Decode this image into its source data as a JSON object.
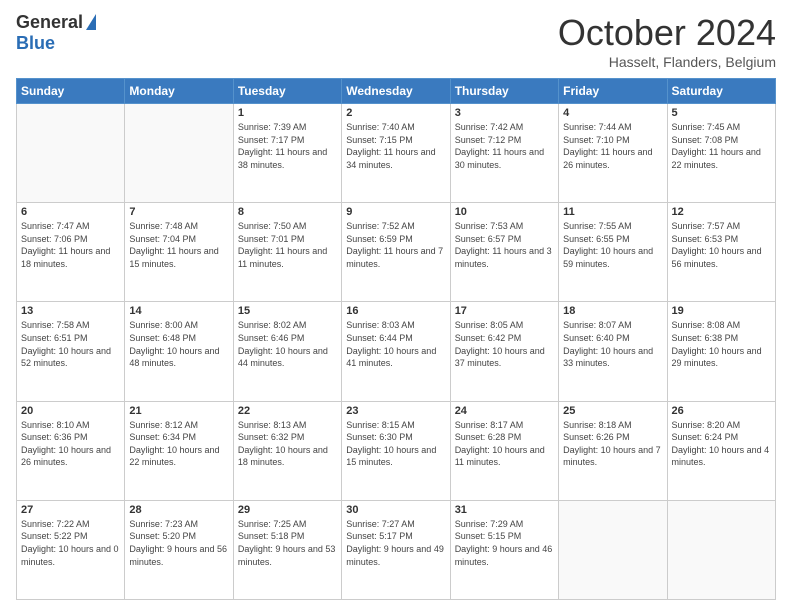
{
  "logo": {
    "general": "General",
    "blue": "Blue"
  },
  "title": "October 2024",
  "subtitle": "Hasselt, Flanders, Belgium",
  "days_of_week": [
    "Sunday",
    "Monday",
    "Tuesday",
    "Wednesday",
    "Thursday",
    "Friday",
    "Saturday"
  ],
  "weeks": [
    [
      {
        "day": "",
        "sunrise": "",
        "sunset": "",
        "daylight": ""
      },
      {
        "day": "",
        "sunrise": "",
        "sunset": "",
        "daylight": ""
      },
      {
        "day": "1",
        "sunrise": "Sunrise: 7:39 AM",
        "sunset": "Sunset: 7:17 PM",
        "daylight": "Daylight: 11 hours and 38 minutes."
      },
      {
        "day": "2",
        "sunrise": "Sunrise: 7:40 AM",
        "sunset": "Sunset: 7:15 PM",
        "daylight": "Daylight: 11 hours and 34 minutes."
      },
      {
        "day": "3",
        "sunrise": "Sunrise: 7:42 AM",
        "sunset": "Sunset: 7:12 PM",
        "daylight": "Daylight: 11 hours and 30 minutes."
      },
      {
        "day": "4",
        "sunrise": "Sunrise: 7:44 AM",
        "sunset": "Sunset: 7:10 PM",
        "daylight": "Daylight: 11 hours and 26 minutes."
      },
      {
        "day": "5",
        "sunrise": "Sunrise: 7:45 AM",
        "sunset": "Sunset: 7:08 PM",
        "daylight": "Daylight: 11 hours and 22 minutes."
      }
    ],
    [
      {
        "day": "6",
        "sunrise": "Sunrise: 7:47 AM",
        "sunset": "Sunset: 7:06 PM",
        "daylight": "Daylight: 11 hours and 18 minutes."
      },
      {
        "day": "7",
        "sunrise": "Sunrise: 7:48 AM",
        "sunset": "Sunset: 7:04 PM",
        "daylight": "Daylight: 11 hours and 15 minutes."
      },
      {
        "day": "8",
        "sunrise": "Sunrise: 7:50 AM",
        "sunset": "Sunset: 7:01 PM",
        "daylight": "Daylight: 11 hours and 11 minutes."
      },
      {
        "day": "9",
        "sunrise": "Sunrise: 7:52 AM",
        "sunset": "Sunset: 6:59 PM",
        "daylight": "Daylight: 11 hours and 7 minutes."
      },
      {
        "day": "10",
        "sunrise": "Sunrise: 7:53 AM",
        "sunset": "Sunset: 6:57 PM",
        "daylight": "Daylight: 11 hours and 3 minutes."
      },
      {
        "day": "11",
        "sunrise": "Sunrise: 7:55 AM",
        "sunset": "Sunset: 6:55 PM",
        "daylight": "Daylight: 10 hours and 59 minutes."
      },
      {
        "day": "12",
        "sunrise": "Sunrise: 7:57 AM",
        "sunset": "Sunset: 6:53 PM",
        "daylight": "Daylight: 10 hours and 56 minutes."
      }
    ],
    [
      {
        "day": "13",
        "sunrise": "Sunrise: 7:58 AM",
        "sunset": "Sunset: 6:51 PM",
        "daylight": "Daylight: 10 hours and 52 minutes."
      },
      {
        "day": "14",
        "sunrise": "Sunrise: 8:00 AM",
        "sunset": "Sunset: 6:48 PM",
        "daylight": "Daylight: 10 hours and 48 minutes."
      },
      {
        "day": "15",
        "sunrise": "Sunrise: 8:02 AM",
        "sunset": "Sunset: 6:46 PM",
        "daylight": "Daylight: 10 hours and 44 minutes."
      },
      {
        "day": "16",
        "sunrise": "Sunrise: 8:03 AM",
        "sunset": "Sunset: 6:44 PM",
        "daylight": "Daylight: 10 hours and 41 minutes."
      },
      {
        "day": "17",
        "sunrise": "Sunrise: 8:05 AM",
        "sunset": "Sunset: 6:42 PM",
        "daylight": "Daylight: 10 hours and 37 minutes."
      },
      {
        "day": "18",
        "sunrise": "Sunrise: 8:07 AM",
        "sunset": "Sunset: 6:40 PM",
        "daylight": "Daylight: 10 hours and 33 minutes."
      },
      {
        "day": "19",
        "sunrise": "Sunrise: 8:08 AM",
        "sunset": "Sunset: 6:38 PM",
        "daylight": "Daylight: 10 hours and 29 minutes."
      }
    ],
    [
      {
        "day": "20",
        "sunrise": "Sunrise: 8:10 AM",
        "sunset": "Sunset: 6:36 PM",
        "daylight": "Daylight: 10 hours and 26 minutes."
      },
      {
        "day": "21",
        "sunrise": "Sunrise: 8:12 AM",
        "sunset": "Sunset: 6:34 PM",
        "daylight": "Daylight: 10 hours and 22 minutes."
      },
      {
        "day": "22",
        "sunrise": "Sunrise: 8:13 AM",
        "sunset": "Sunset: 6:32 PM",
        "daylight": "Daylight: 10 hours and 18 minutes."
      },
      {
        "day": "23",
        "sunrise": "Sunrise: 8:15 AM",
        "sunset": "Sunset: 6:30 PM",
        "daylight": "Daylight: 10 hours and 15 minutes."
      },
      {
        "day": "24",
        "sunrise": "Sunrise: 8:17 AM",
        "sunset": "Sunset: 6:28 PM",
        "daylight": "Daylight: 10 hours and 11 minutes."
      },
      {
        "day": "25",
        "sunrise": "Sunrise: 8:18 AM",
        "sunset": "Sunset: 6:26 PM",
        "daylight": "Daylight: 10 hours and 7 minutes."
      },
      {
        "day": "26",
        "sunrise": "Sunrise: 8:20 AM",
        "sunset": "Sunset: 6:24 PM",
        "daylight": "Daylight: 10 hours and 4 minutes."
      }
    ],
    [
      {
        "day": "27",
        "sunrise": "Sunrise: 7:22 AM",
        "sunset": "Sunset: 5:22 PM",
        "daylight": "Daylight: 10 hours and 0 minutes."
      },
      {
        "day": "28",
        "sunrise": "Sunrise: 7:23 AM",
        "sunset": "Sunset: 5:20 PM",
        "daylight": "Daylight: 9 hours and 56 minutes."
      },
      {
        "day": "29",
        "sunrise": "Sunrise: 7:25 AM",
        "sunset": "Sunset: 5:18 PM",
        "daylight": "Daylight: 9 hours and 53 minutes."
      },
      {
        "day": "30",
        "sunrise": "Sunrise: 7:27 AM",
        "sunset": "Sunset: 5:17 PM",
        "daylight": "Daylight: 9 hours and 49 minutes."
      },
      {
        "day": "31",
        "sunrise": "Sunrise: 7:29 AM",
        "sunset": "Sunset: 5:15 PM",
        "daylight": "Daylight: 9 hours and 46 minutes."
      },
      {
        "day": "",
        "sunrise": "",
        "sunset": "",
        "daylight": ""
      },
      {
        "day": "",
        "sunrise": "",
        "sunset": "",
        "daylight": ""
      }
    ]
  ]
}
